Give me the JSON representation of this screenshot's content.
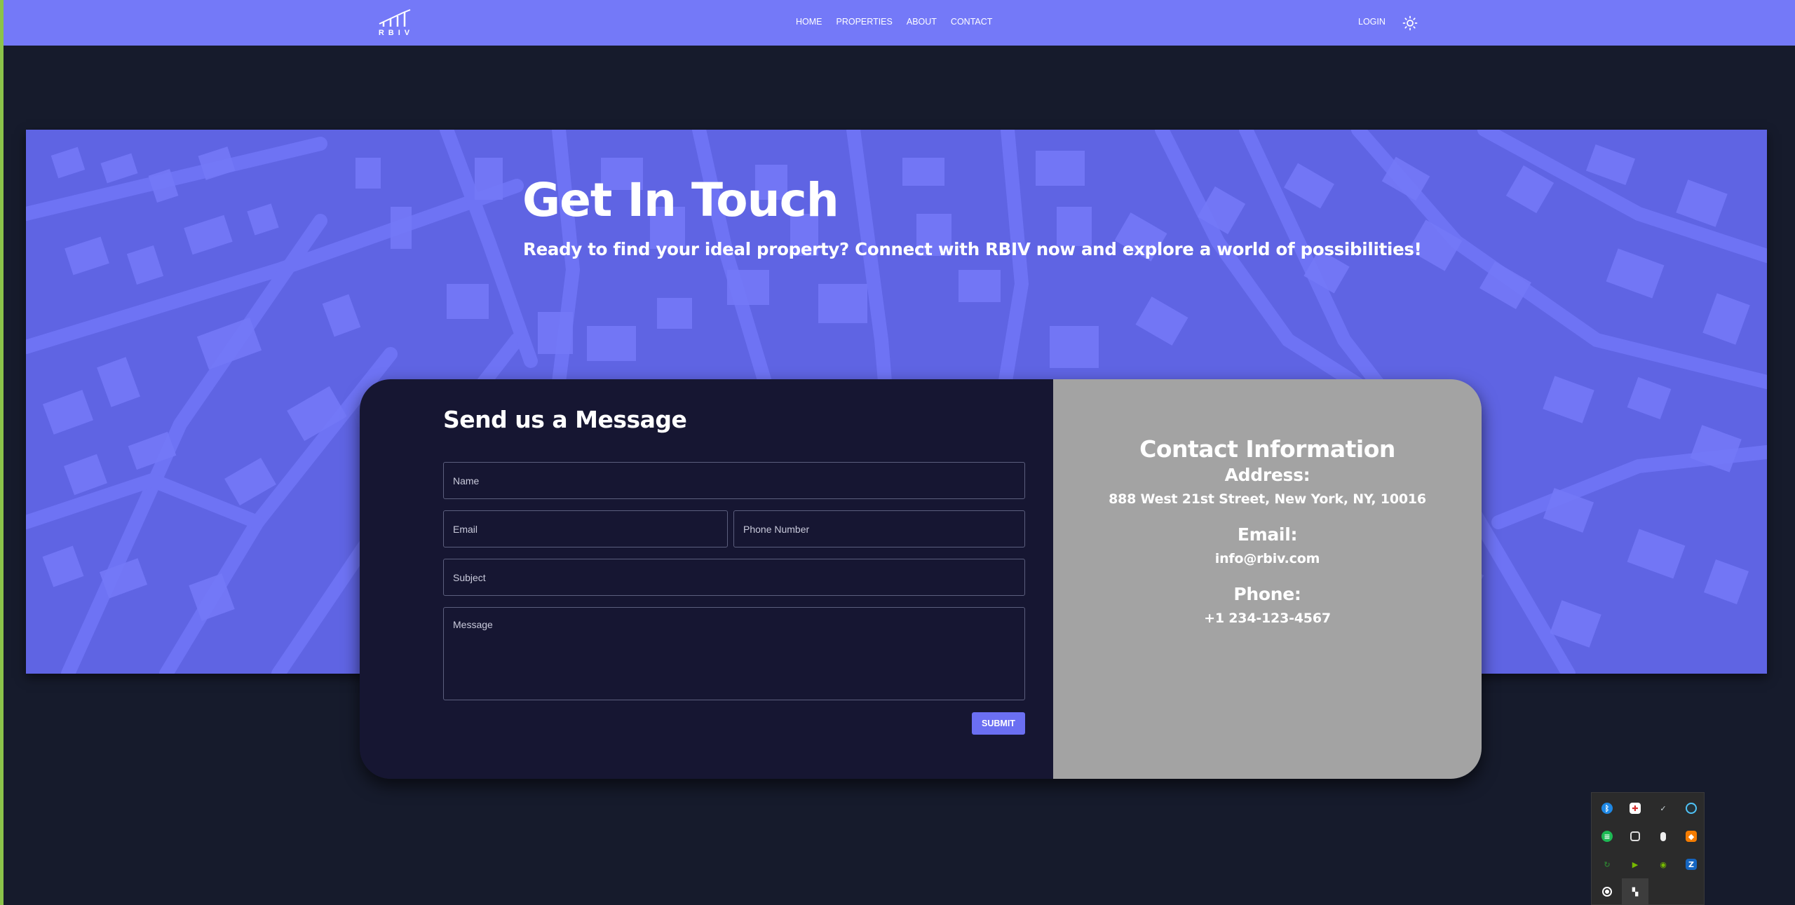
{
  "brand": {
    "logo_text": "RBIV"
  },
  "nav": {
    "links": [
      {
        "label": "HOME"
      },
      {
        "label": "PROPERTIES"
      },
      {
        "label": "ABOUT"
      },
      {
        "label": "CONTACT"
      }
    ],
    "login_label": "LOGIN",
    "theme_icon": "sun-icon"
  },
  "hero": {
    "title": "Get In Touch",
    "subtitle": "Ready to find your ideal property? Connect with RBIV now and explore a world of possibilities!"
  },
  "form": {
    "title": "Send us a Message",
    "name_placeholder": "Name",
    "email_placeholder": "Email",
    "phone_placeholder": "Phone Number",
    "subject_placeholder": "Subject",
    "message_placeholder": "Message",
    "submit_label": "SUBMIT"
  },
  "contact_info": {
    "title": "Contact Information",
    "address_label": "Address:",
    "address_value": "888 West 21st Street, New York, NY, 10016",
    "email_label": "Email:",
    "email_value": "info@rbiv.com",
    "phone_label": "Phone:",
    "phone_value": "+1 234-123-4567"
  },
  "tray": {
    "icons": [
      "bluetooth-icon",
      "security-shield-icon",
      "steam-icon",
      "circle-app-icon",
      "spotify-icon",
      "screenshot-tool-icon",
      "microphone-icon",
      "ruby-app-icon",
      "sync-icon",
      "nvidia-play-icon",
      "nvidia-icon",
      "zoom-icon",
      "record-icon",
      "app-grid-icon"
    ],
    "colors": {
      "accent": "#7479f8",
      "card_dark": "#161632",
      "card_gray": "#a3a3a3",
      "page_bg": "#161b2c"
    }
  }
}
